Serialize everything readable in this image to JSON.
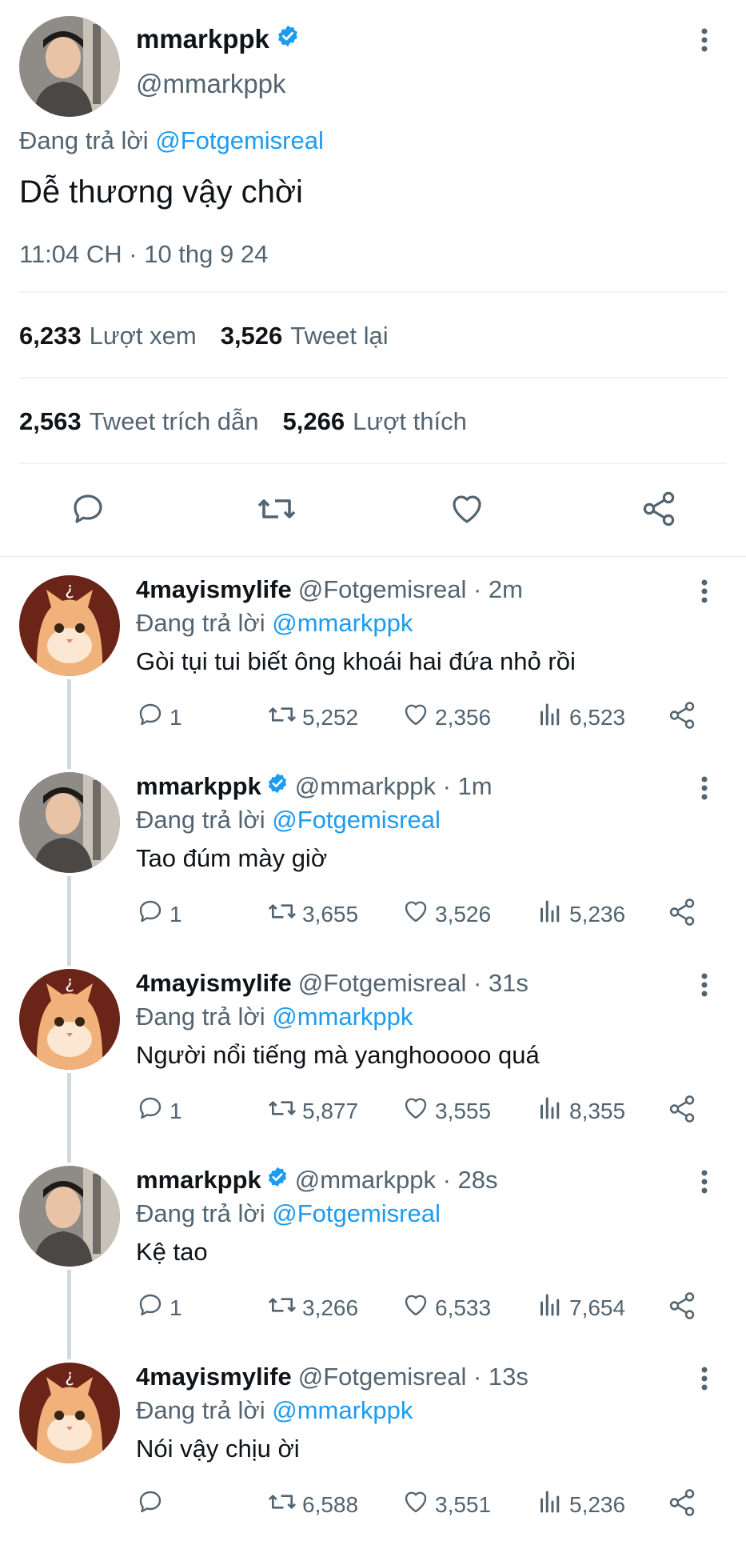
{
  "main_tweet": {
    "display_name": "mmarkppk",
    "handle": "@mmarkppk",
    "replying_prefix": "Đang trả lời ",
    "replying_to": "@Fotgemisreal",
    "text": "Dễ thương vậy chời",
    "timestamp": "11:04 CH · 10 thg 9 24",
    "views_count": "6,233",
    "views_label": "Lượt xem",
    "retweets_count": "3,526",
    "retweets_label": "Tweet lại",
    "quotes_count": "2,563",
    "quotes_label": "Tweet trích dẫn",
    "likes_count": "5,266",
    "likes_label": "Lượt thích"
  },
  "colors": {
    "accent": "#1d9bf0",
    "secondary_text": "#536471",
    "primary_text": "#0f1419",
    "divider": "#eff3f4"
  },
  "icons": {
    "reply": "reply-icon",
    "retweet": "retweet-icon",
    "like": "heart-icon",
    "views": "views-icon",
    "share": "share-icon",
    "more": "more-icon",
    "verified": "verified-icon"
  },
  "replies": [
    {
      "display_name": "4mayismylife",
      "meta": "@Fotgemisreal · 2m",
      "replying_prefix": "Đang trả lời ",
      "replying_to": "@mmarkppk",
      "text": "Gòi tụi tui biết ông khoái hai đứa nhỏ rồi",
      "replies": "1",
      "retweets": "5,252",
      "likes": "2,356",
      "views": "6,523"
    },
    {
      "display_name": "mmarkppk",
      "meta": "@mmarkppk · 1m",
      "replying_prefix": "Đang trả lời ",
      "replying_to": "@Fotgemisreal",
      "text": "Tao đúm mày giờ",
      "replies": "1",
      "retweets": "3,655",
      "likes": "3,526",
      "views": "5,236"
    },
    {
      "display_name": "4mayismylife",
      "meta": "@Fotgemisreal · 31s",
      "replying_prefix": "Đang trả lời ",
      "replying_to": "@mmarkppk",
      "text": "Người nổi tiếng mà yanghooooo quá",
      "replies": "1",
      "retweets": "5,877",
      "likes": "3,555",
      "views": "8,355"
    },
    {
      "display_name": "mmarkppk",
      "meta": "@mmarkppk · 28s",
      "replying_prefix": "Đang trả lời ",
      "replying_to": "@Fotgemisreal",
      "text": "Kệ tao",
      "replies": "1",
      "retweets": "3,266",
      "likes": "6,533",
      "views": "7,654"
    },
    {
      "display_name": "4mayismylife",
      "meta": "@Fotgemisreal · 13s",
      "replying_prefix": "Đang trả lời ",
      "replying_to": "@mmarkppk",
      "text": "Nói vậy chịu ời",
      "replies": "",
      "retweets": "6,588",
      "likes": "3,551",
      "views": "5,236"
    }
  ]
}
